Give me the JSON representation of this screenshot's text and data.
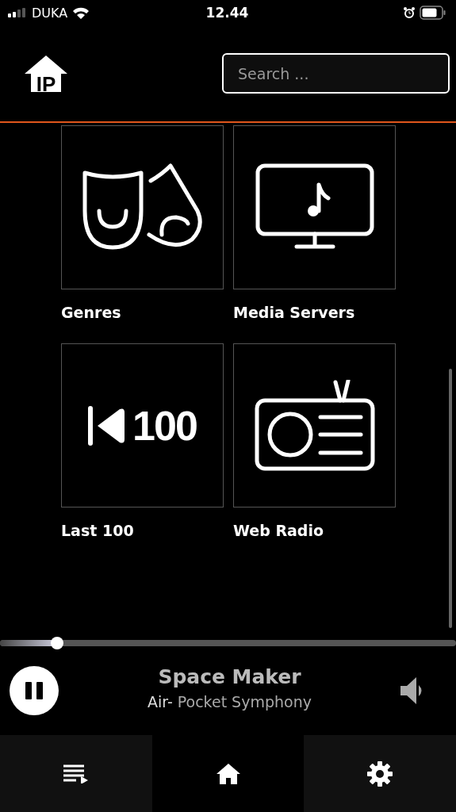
{
  "status_bar": {
    "carrier": "DUKA",
    "time": "12.44"
  },
  "header": {
    "logo_text": "IP",
    "search": {
      "placeholder": "Search ..."
    }
  },
  "tiles": [
    {
      "kind": "masks",
      "label": "Genres"
    },
    {
      "kind": "monitor",
      "label": "Media Servers"
    },
    {
      "kind": "last100",
      "label": "Last 100",
      "icon_text": "100"
    },
    {
      "kind": "radio",
      "label": "Web Radio"
    }
  ],
  "player": {
    "level": 0.125,
    "title": "Space Maker",
    "artist": "Air-",
    "album": "Pocket Symphony",
    "playing": true
  },
  "nav": [
    {
      "kind": "queue",
      "selected": false
    },
    {
      "kind": "home",
      "selected": true
    },
    {
      "kind": "settings",
      "selected": false
    }
  ]
}
